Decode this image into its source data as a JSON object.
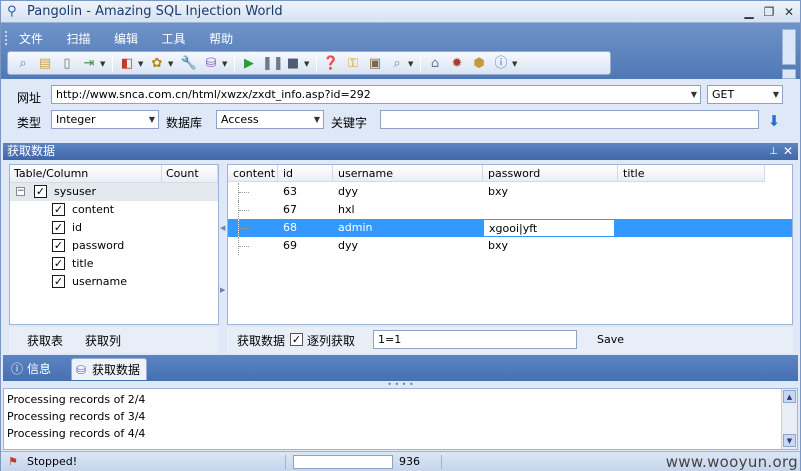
{
  "window": {
    "title": "Pangolin - Amazing SQL Injection World",
    "minimize_glyph": "▁",
    "restore_glyph": "❐",
    "close_glyph": "✕"
  },
  "menu": {
    "items": [
      "文件",
      "扫描",
      "编辑",
      "工具",
      "帮助"
    ]
  },
  "toolbar": {
    "icons": [
      "search-icon",
      "notes-icon",
      "document-icon",
      "export-icon",
      "tag-icon",
      "palette-icon",
      "wrench-icon",
      "database-icon",
      "play-icon",
      "pause-icon",
      "stop-icon",
      "help-icon",
      "key-icon",
      "id-card-icon",
      "magnifier-icon",
      "home-icon",
      "bug-icon",
      "box-icon",
      "info-icon"
    ]
  },
  "url_row": {
    "url_label": "网址",
    "url_value": "http://www.snca.com.cn/html/xwzx/zxdt_info.asp?id=292",
    "method_value": "GET"
  },
  "type_row": {
    "type_label": "类型",
    "type_value": "Integer",
    "db_label": "数据库",
    "db_value": "Access",
    "keyword_label": "关键字",
    "keyword_value": ""
  },
  "panel": {
    "title": "获取数据",
    "pin_glyph": "ꟷ",
    "close_glyph": "✕"
  },
  "tree": {
    "col_table": "Table/Column",
    "col_count": "Count",
    "root": {
      "label": "sysuser",
      "checked": true
    },
    "columns": [
      {
        "label": "content",
        "checked": true
      },
      {
        "label": "id",
        "checked": true
      },
      {
        "label": "password",
        "checked": true
      },
      {
        "label": "title",
        "checked": true
      },
      {
        "label": "username",
        "checked": true
      }
    ],
    "get_tables_label": "获取表",
    "get_columns_label": "获取列"
  },
  "grid": {
    "headers": [
      "content",
      "id",
      "username",
      "password",
      "title"
    ],
    "rows": [
      {
        "content": "",
        "id": "63",
        "username": "dyy",
        "password": "bxy",
        "title": ""
      },
      {
        "content": "",
        "id": "67",
        "username": "hxl",
        "password": "",
        "title": ""
      },
      {
        "content": "",
        "id": "68",
        "username": "admin",
        "password": "xgooi|yft",
        "title": "",
        "selected": true
      },
      {
        "content": "",
        "id": "69",
        "username": "dyy",
        "password": "bxy",
        "title": ""
      }
    ]
  },
  "data_actions": {
    "fetch_label": "获取数据",
    "one_by_one_label": "逐列获取",
    "one_by_one_checked": true,
    "condition_value": "1=1",
    "save_label": "Save"
  },
  "bottom_tabs": [
    {
      "label": "信息",
      "active": false
    },
    {
      "label": "获取数据",
      "active": true
    }
  ],
  "log": {
    "lines": [
      "Processing records of 2/4",
      "Processing records of 3/4",
      "Processing records of 4/4"
    ]
  },
  "status": {
    "text": "Stopped!",
    "progress": 0,
    "count": "936",
    "watermark": "www.wooyun.org"
  }
}
